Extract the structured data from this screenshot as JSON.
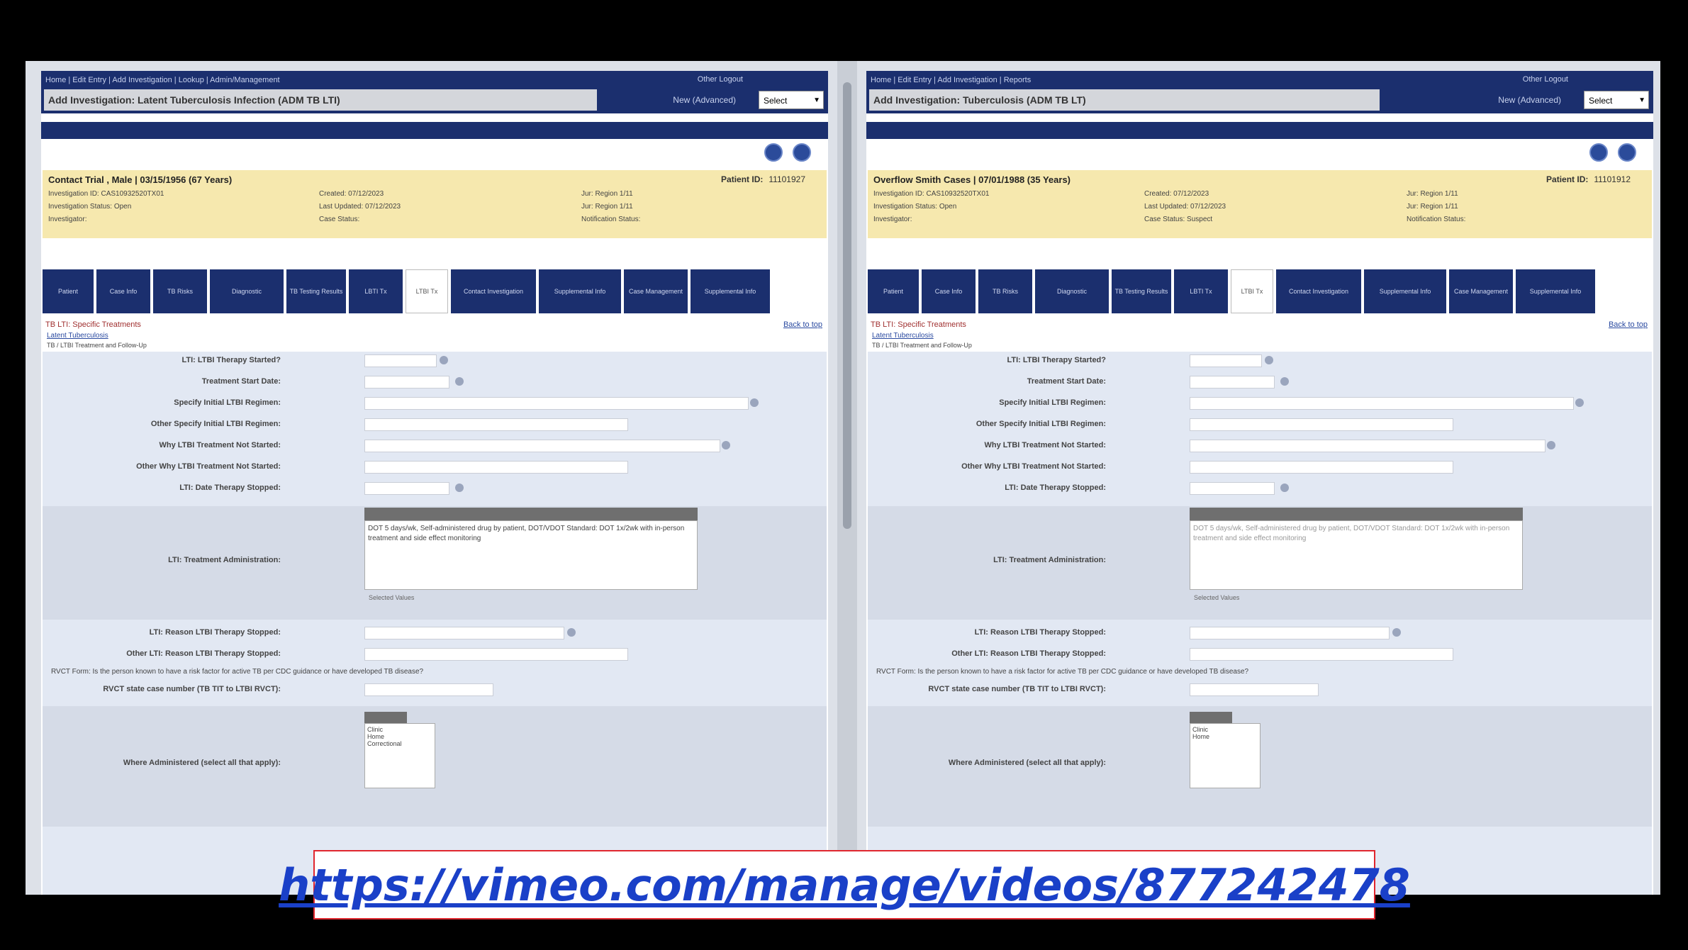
{
  "link": {
    "url": "https://vimeo.com/manage/videos/877242478"
  },
  "left_panel": {
    "menu": "Home | Edit Entry | Add Investigation | Lookup | Admin/Management",
    "user": "Other Logout",
    "title": "Add Investigation: Latent Tuberculosis Infection (ADM TB LTI)",
    "advanced": "New (Advanced)",
    "select": "Select",
    "patient_name": "Contact Trial , Male | 03/15/1956 (67 Years)",
    "patient_id_label": "Patient ID:",
    "patient_id": "11101927",
    "info": [
      "Investigation ID: CAS10932520TX01",
      "Investigation Status: Open",
      "Investigator:",
      "Created: 07/12/2023",
      "Last Updated: 07/12/2023",
      "Case Status:",
      "Jur: Region 1/11",
      "Jur: Region 1/11",
      "Notification Status:"
    ],
    "tabs": [
      "Patient",
      "Case Info",
      "TB Risks",
      "Diagnostic",
      "TB Testing Results",
      "LBTI Tx",
      "LTBI Tx",
      "Contact Investigation",
      "Supplemental Info",
      "Case Management",
      "Supplemental Info"
    ],
    "section": "TB LTI: Specific Treatments",
    "back_link": "Back to top",
    "sub_link": "Latent Tuberculosis",
    "sub_text": "TB / LTBI Treatment and Follow-Up",
    "fields": [
      "LTI: LTBI Therapy Started?",
      "Treatment Start Date:",
      "Specify Initial LTBI Regimen:",
      "Other Specify Initial LTBI Regimen:",
      "Why LTBI Treatment Not Started:",
      "Other Why LTBI Treatment Not Started:",
      "LTI: Date Therapy Stopped:"
    ],
    "notes_label": "LTI: Treatment Administration:",
    "notes_text": "DOT 5 days/wk, Self-administered drug by patient, DOT/VDOT Standard: DOT 1x/2wk with in-person treatment and side effect monitoring",
    "notes_caption": "Selected Values",
    "fields2": [
      "LTI: Reason LTBI Therapy Stopped:",
      "Other LTI: Reason LTBI Therapy Stopped:"
    ],
    "long_label": "RVCT Form: Is the person known to have a risk factor for active TB per CDC guidance or have developed TB disease?",
    "long_label2": "RVCT state case number (TB TIT to LTBI RVCT):",
    "list_label": "Where Administered (select all that apply):",
    "list_items": [
      "Clinic",
      "Home",
      "Correctional"
    ]
  },
  "right_panel": {
    "menu": "Home | Edit Entry | Add Investigation | Reports",
    "user": "Other Logout",
    "title": "Add Investigation: Tuberculosis (ADM TB LT)",
    "advanced": "New (Advanced)",
    "select": "Select",
    "patient_name": "Overflow Smith Cases | 07/01/1988 (35 Years)",
    "patient_id_label": "Patient ID:",
    "patient_id": "11101912",
    "info": [
      "Investigation ID: CAS10932520TX01",
      "Investigation Status: Open",
      "Investigator:",
      "Created: 07/12/2023",
      "Last Updated: 07/12/2023",
      "Case Status: Suspect",
      "Jur: Region 1/11",
      "Jur: Region 1/11",
      "Notification Status:"
    ],
    "tabs": [
      "Patient",
      "Case Info",
      "TB Risks",
      "Diagnostic",
      "TB Testing Results",
      "LBTI Tx",
      "LTBI Tx",
      "Contact Investigation",
      "Supplemental Info",
      "Case Management",
      "Supplemental Info"
    ],
    "section": "TB LTI: Specific Treatments",
    "back_link": "Back to top",
    "sub_link": "Latent Tuberculosis",
    "sub_text": "TB / LTBI Treatment and Follow-Up",
    "fields": [
      "LTI: LTBI Therapy Started?",
      "Treatment Start Date:",
      "Specify Initial LTBI Regimen:",
      "Other Specify Initial LTBI Regimen:",
      "Why LTBI Treatment Not Started:",
      "Other Why LTBI Treatment Not Started:",
      "LTI: Date Therapy Stopped:"
    ],
    "notes_label": "LTI: Treatment Administration:",
    "notes_text": "DOT 5 days/wk, Self-administered drug by patient, DOT/VDOT Standard: DOT 1x/2wk with in-person treatment and side effect monitoring",
    "notes_caption": "Selected Values",
    "fields2": [
      "LTI: Reason LTBI Therapy Stopped:",
      "Other LTI: Reason LTBI Therapy Stopped:"
    ],
    "long_label": "RVCT Form: Is the person known to have a risk factor for active TB per CDC guidance or have developed TB disease?",
    "long_label2": "RVCT state case number (TB TIT to LTBI RVCT):",
    "list_label": "Where Administered (select all that apply):",
    "list_items": [
      "Clinic",
      "Home"
    ]
  }
}
